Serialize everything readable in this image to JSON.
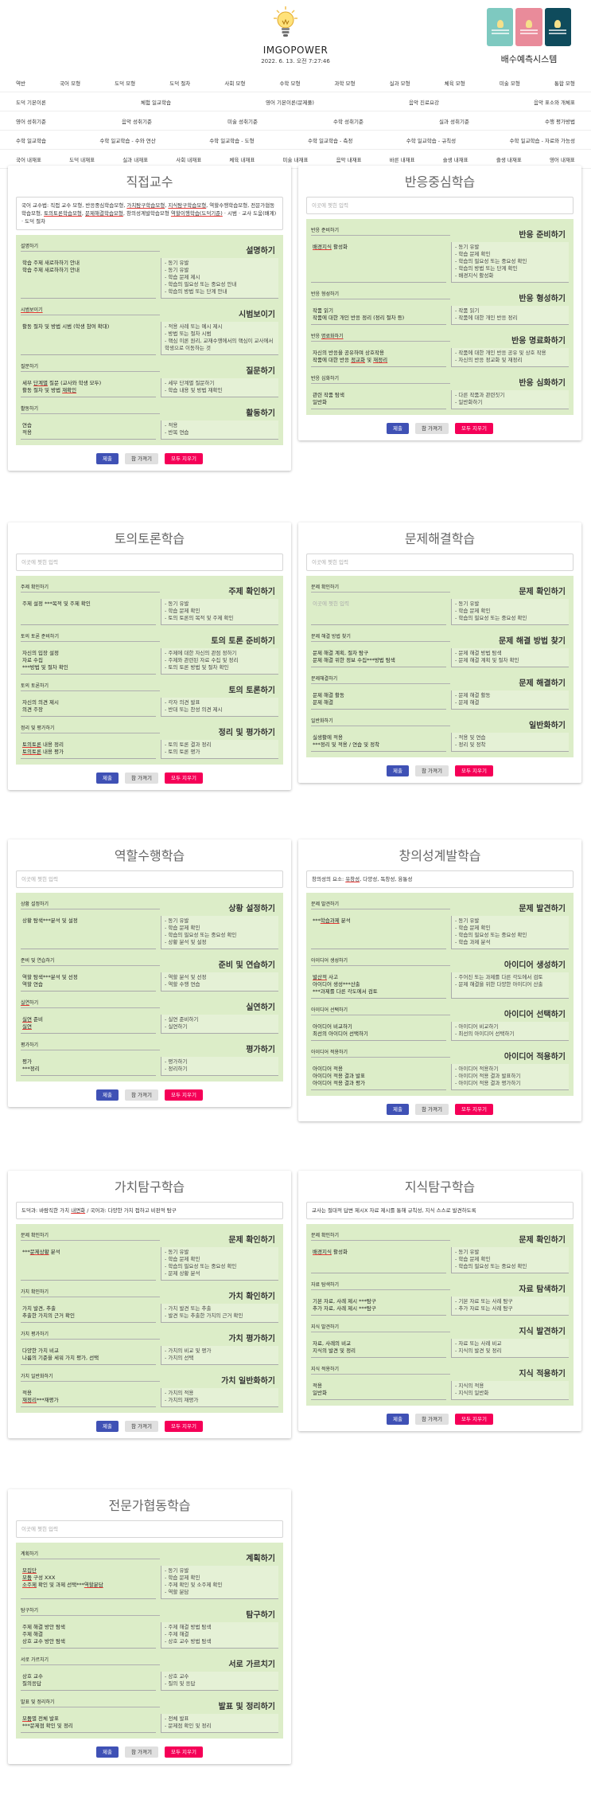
{
  "header": {
    "title": "IMGOPOWER",
    "datetime": "2022. 6. 13. 오전 7:27:46",
    "ext_title": "배수예측시스템",
    "thumb_colors": [
      "#7ec9c0",
      "#e98b9a",
      "#0f4b5c"
    ],
    "icon": "lightbulb-logo"
  },
  "nav": {
    "rows": [
      [
        "역반",
        "국어 모형",
        "도덕 모형",
        "도덕 절차",
        "사회 모형",
        "수학 모형",
        "과학 모형",
        "실과 모형",
        "체육 모형",
        "미술 모형",
        "통합 모형"
      ],
      [
        "도덕 기본이론",
        "체험 일교학습",
        "영어 기본이론(문제풀)",
        "음악 진료요강",
        "음악 표소와 개체표"
      ],
      [
        "영어 성취기준",
        "음악 성취기준",
        "미술 성취기준",
        "수학 성취기준",
        "실과 성취기준",
        "수행 평가방법"
      ],
      [
        "수학 일교학습",
        "수학 일교학습 - 수와 연산",
        "수학 일교학습 - 도형",
        "수학 일교학습 - 측정",
        "수학 일교학습 - 규칙성",
        "수학 일교학습 - 자료와 가능성"
      ],
      [
        "국어 내재표",
        "도덕 내재표",
        "실과 내재표",
        "사회 내재표",
        "체육 내재표",
        "미술 내재표",
        "음악 내재표",
        "바른 내재표",
        "슬생 내재표",
        "즐생 내재표",
        "영어 내재표"
      ]
    ]
  },
  "buttons": {
    "submit": "제출",
    "load": "참 가져기",
    "clear": "모두 지우기"
  },
  "cards": [
    {
      "title": "직접교수",
      "top_text": "국어 교수법: 직접 교수 모형, 반응중심학습모형, 가치탐구학습모형, 지식탐구학습모형, 역할수행학습모형, 전문가협동학습모형, 토의토론학습모형, 문제해결학습모형, 창의성계발학습모형 역할이행학습(도덕기준) · 시범 · 교사 도움(배계) · 도덕 절차",
      "sections": [
        {
          "label": "설명하기",
          "heading": "설명하기",
          "text": "학습 주제 새로하하기 안내\n학습 주제 새로하하기 안내",
          "guide": "- 동기 유발\n- 동기 유발\n- 학습 문제 제시\n- 학습의 필요성 또는 중요성 안내\n- 학습의 방법 또는 단계 안내"
        },
        {
          "label": "시범보이기",
          "heading": "시범보이기",
          "text": "활동 절차 및 방법 시범 (학생 참여 확대)",
          "guide": "- 적용 사례 또는 예시 제시\n- 방법 또는 절차 시범\n- 핵심 이론 원리, 교재수행에서의 핵심이 교사에서 학생으로 이동하는 것"
        },
        {
          "label": "질문하기",
          "heading": "질문하기",
          "text": "세부 단계별 질문 (교사와 학생 모두)\n활동 절차 및 방법 재확인",
          "guide": "- 세부 단계별 질문하기\n- 학습 내용 및 방법 재확인"
        },
        {
          "label": "활동하기",
          "heading": "활동하기",
          "text": "연습\n적용",
          "guide": "- 적용\n- 반복 연습"
        }
      ]
    },
    {
      "title": "반응중심학습",
      "top_text": "",
      "top_placeholder": "이곳에 쳇힌 입력",
      "sections": [
        {
          "label": "반응 준비하기",
          "heading": "반응 준비하기",
          "text": "배경지식 활성화",
          "guide": "- 동기 유발\n- 학습 문제 확인\n- 학습의 필요성 또는 중요성 확인\n- 학습의 방법 또는 단계 확인\n- 배경지식 활성화"
        },
        {
          "label": "반응 형성하기",
          "heading": "반응 형성하기",
          "text": "작품 읽기\n작품에 대한 개인 반응 정리 (정리 절차 등)",
          "guide": "- 작품 읽기\n- 작품에 대한 개인 반응 정리"
        },
        {
          "label": "반응 명료화하기",
          "heading": "반응 명료화하기",
          "text": "자신의 반응을 공유하며 상호작용\n작품에 대한 반응 정교화 및 재정리",
          "guide": "- 작품에 대한 개인 반응 공유 및 상호 작용\n- 자신의 반응 정교화 및 재정리"
        },
        {
          "label": "반응 심화하기",
          "heading": "반응 심화하기",
          "text": "관련 작품 탐색\n일반화",
          "guide": "- 다른 작품과 관련짓기\n- 일반화하기"
        }
      ]
    },
    {
      "title": "토의토론학습",
      "top_text": "",
      "top_placeholder": "이곳에 쳇힌 입력",
      "sections": [
        {
          "label": "주제 확인하기",
          "heading": "주제 확인하기",
          "text": "주제 설정 ***목적 및 주제 확인",
          "guide": "- 동기 유발\n- 학습 문제 확인\n- 토의 토론의 목적 및 주제 확인"
        },
        {
          "label": "토의 토론 준비하기",
          "heading": "토의 토론 준비하기",
          "text": "자신의 입장 설정\n자료 수집\n***방법 및 절차 확인",
          "guide": "- 주제에 대한 자신의 관점 정하기\n- 주제와 관련된 자료 수집 및 정리\n- 토의 토론 방법 및 절차 확인"
        },
        {
          "label": "토의 토론하기",
          "heading": "토의 토론하기",
          "text": "자신의 의견 제시\n의견 주장",
          "guide": "- 각자 의견 발표\n- 반대 또는 찬성 의견 제시"
        },
        {
          "label": "정리 및 평가하기",
          "heading": "정리 및 평가하기",
          "text": "토의토론 내용 정리\n토의토론 내용 평가",
          "guide": "- 토의 토론 결과 정리\n- 토의 토론 평가"
        }
      ]
    },
    {
      "title": "문제해결학습",
      "top_text": "",
      "top_placeholder": "이곳에 쳇힌 입력",
      "sections": [
        {
          "label": "문제 확인하기",
          "heading": "문제 확인하기",
          "text": "",
          "text_placeholder": "이곳에 쳇힌 입력",
          "guide": "- 동기 유발\n- 학습 문제 확인\n- 학습의 필요성 또는 중요성 확인"
        },
        {
          "label": "문제 해결 방법 찾기",
          "heading": "문제 해결 방법 찾기",
          "text": "문제 해결 계획, 절차 탐구\n문제 해결 위한 정보 수집***방법 탐색",
          "guide": "- 문제 해결 방법 탐색\n- 문제 해결 계획 및 절차 확인"
        },
        {
          "label": "문제해결하기",
          "heading": "문제 해결하기",
          "text": "문제 해결 활동\n문제 해결",
          "guide": "- 문제 해결 활동\n- 문제 해결"
        },
        {
          "label": "일반화하기",
          "heading": "일반화하기",
          "text": "실생활에 적용\n***정리 및 적용 / 연습 및 정착",
          "guide": "- 적용 및 연습\n- 정리 및 정착"
        }
      ]
    },
    {
      "title": "역할수행학습",
      "top_text": "",
      "top_placeholder": "이곳에 쳇힌 입력",
      "sections": [
        {
          "label": "상황 설정하기",
          "heading": "상황 설정하기",
          "text": "상황 탐색***분석 및 설정",
          "guide": "- 동기 유발\n- 학습 문제 확인\n- 학습의 필요성 또는 중요성 확인\n- 상황 분석 및 설정"
        },
        {
          "label": "준비 및 연습하기",
          "heading": "준비 및 연습하기",
          "text": "역할 탐색***분석 및 선정\n역할 연습",
          "guide": "- 역할 분석 및 선정\n- 역할 수행 연습"
        },
        {
          "label": "실연하기",
          "heading": "실연하기",
          "text": "실연 준비\n실연",
          "guide": "- 실연 준비하기\n- 실연하기"
        },
        {
          "label": "평가하기",
          "heading": "평가하기",
          "text": "평가\n***정리",
          "guide": "- 평가하기\n- 정리하기"
        }
      ]
    },
    {
      "title": "창의성계발학습",
      "top_text": "창의성의 요소: 유창성, 다양성, 독창성, 융통성",
      "sections": [
        {
          "label": "문제 발견하기",
          "heading": "문제 발견하기",
          "text": "***학습과제 분석",
          "guide": "- 동기 유발\n- 학습 문제 확인\n- 학습의 필요성 또는 중요성 확인\n- 학습 과제 분석"
        },
        {
          "label": "아이디어 생성하기",
          "heading": "아이디어 생성하기",
          "text": "발산적 사고\n아이디어 생성***산출\n***과제를 다른 각도에서 검토",
          "guide": "- 주어진 또는 과제를 다른 각도에서 검토\n- 문제 해결을 위한 다양한 아이디어 산출"
        },
        {
          "label": "아이디어 선택하기",
          "heading": "아이디어 선택하기",
          "text": "아이디어 비교하기\n최선의 아이디어 선택하기",
          "guide": "- 아이디어 비교하기\n- 최선의 아이디어 선택하기"
        },
        {
          "label": "아이디어 적용하기",
          "heading": "아이디어 적용하기",
          "text": "아이디어 적용\n아이디어 적용 결과 발표\n아이디어 적용 결과 평가",
          "guide": "- 아이디어 적용하기\n- 아이디어 적용 결과 발표하기\n- 아이디어 적용 결과 평가하기"
        }
      ]
    },
    {
      "title": "가치탐구학습",
      "top_text": "도덕과: 바람직한 가치 내면화 / 국어과: 다양한 가치 접하고 비판적 탐구",
      "sections": [
        {
          "label": "문제 확인하기",
          "heading": "문제 확인하기",
          "text": "***문제상황 분석",
          "guide": "- 동기 유발\n- 학습 문제 확인\n- 학습의 필요성 또는 중요성 확인\n- 문제 상황 분석"
        },
        {
          "label": "가치 확인하기",
          "heading": "가치 확인하기",
          "text": "가치 발견, 추출\n추출한 가치의 근거 확인",
          "guide": "- 가치 발견 또는 추출\n- 발견 또는 추출한 가치의 근거 확인"
        },
        {
          "label": "가치 평가하기",
          "heading": "가치 평가하기",
          "text": "다양한 가치 비교\n나름의 기준을 세워 가치 평가, 선택",
          "guide": "- 가치의 비교 및 평가\n- 가치의 선택"
        },
        {
          "label": "가치 일반화하기",
          "heading": "가치 일반화하기",
          "text": "적용\n재정리***재평가",
          "guide": "- 가치의 적용\n- 가치의 재평가"
        }
      ]
    },
    {
      "title": "지식탐구학습",
      "top_text": "교사는 절대적 답변 제시X 자료 제시를 통해 규칙성, 지식 스스로 발견하도록",
      "sections": [
        {
          "label": "문제 확인하기",
          "heading": "문제 확인하기",
          "text": "배경지식 활성화",
          "guide": "- 동기 유발\n- 학습 문제 확인\n- 학습의 필요성 또는 중요성 확인"
        },
        {
          "label": "자료 탐색하기",
          "heading": "자료 탐색하기",
          "text": "기본 자료, 사례 제시 ***탐구\n추가 자료, 사례 제시 ***탐구",
          "guide": "- 기본 자료 또는 사례 탐구\n- 추가 자료 또는 사례 탐구"
        },
        {
          "label": "지식 발견하기",
          "heading": "지식 발견하기",
          "text": "자료, 사례의 비교\n지식의 발견 및 정리",
          "guide": "- 자료 또는 사례 비교\n- 지식의 발견 및 정리"
        },
        {
          "label": "지식 적용하기",
          "heading": "지식 적용하기",
          "text": "적용\n일반화",
          "guide": "- 지식의 적용\n- 지식의 일반화"
        }
      ]
    },
    {
      "title": "전문가협동학습",
      "top_text": "",
      "top_placeholder": "이곳에 쳇힌 입력",
      "sections": [
        {
          "label": "계획하기",
          "heading": "계획하기",
          "text": "모집단\n모둠 구성 XXX\n소주제 확인 및 과제 선택***역할분담",
          "guide": "- 동기 유발\n- 학습 문제 확인\n- 주제 확인 및 소주제 확인\n- 역할 분담"
        },
        {
          "label": "탐구하기",
          "heading": "탐구하기",
          "text": "주제 해결 방안 탐색\n주제 해결\n상호 교수 방안 탐색",
          "guide": "- 주제 해결 방법 탐색\n- 주제 해결\n- 상호 교수 방법 탐색"
        },
        {
          "label": "서로 가르치기",
          "heading": "서로 가르치기",
          "text": "상호 교수\n질의응답",
          "guide": "- 상호 교수\n- 질의 및 응답"
        },
        {
          "label": "발표 및 정리하기",
          "heading": "발표 및 정리하기",
          "text": "모둠별 전체 발표\n***문제점 확인 및 정리",
          "guide": "- 전체 발표\n- 문제점 확인 및 정리"
        }
      ]
    }
  ]
}
